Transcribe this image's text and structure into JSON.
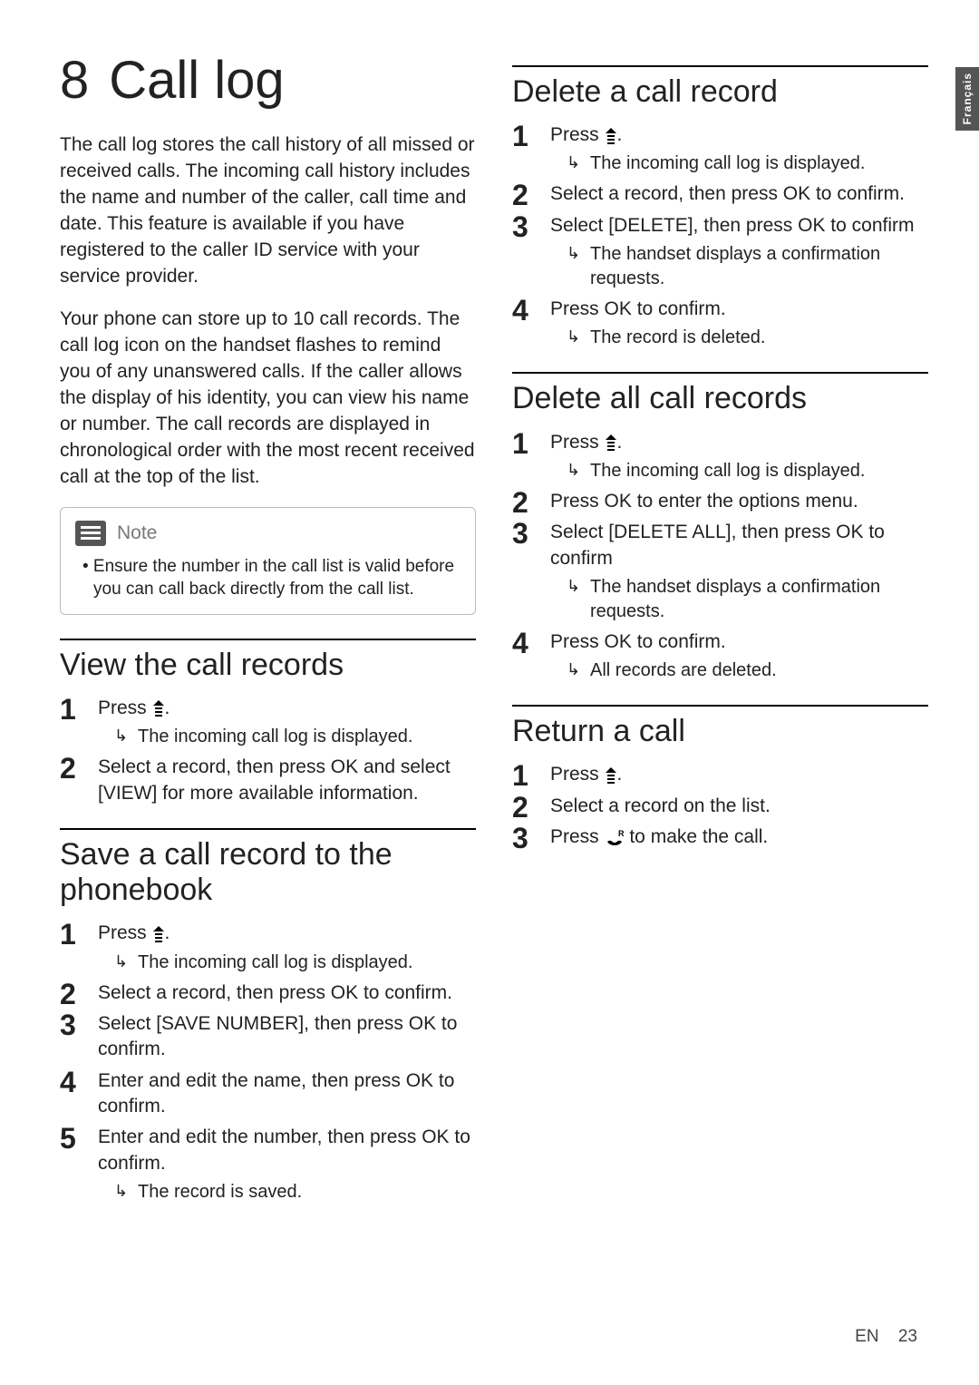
{
  "chapter": {
    "number": "8",
    "title": "Call log"
  },
  "intro_p1": "The call log stores the call history of all missed or received calls. The incoming call history includes the name and number of the caller, call time and date. This feature is available if you have registered to the caller ID service with your service provider.",
  "intro_p2": "Your phone can store up to 10 call records. The call log icon on the handset flashes to remind you of any unanswered calls. If the caller allows the display of his identity, you can view his name or number. The call records are displayed in chronological order with the most recent received call at the top of the list.",
  "note": {
    "label": "Note",
    "body": "• Ensure the number in the call list is valid before you can call back directly from the call list."
  },
  "sections": {
    "view": {
      "title": "View the call records",
      "steps": [
        {
          "text": "Press ",
          "icon": "up-menu",
          "after": ".",
          "sub": [
            "The incoming call log is displayed."
          ]
        },
        {
          "text": "Select a record, then press OK and select [VIEW] for more available information."
        }
      ]
    },
    "save": {
      "title": "Save a call record to the phonebook",
      "steps": [
        {
          "text": "Press ",
          "icon": "up-menu",
          "after": ".",
          "sub": [
            "The incoming call log is displayed."
          ]
        },
        {
          "text": "Select a record, then press OK to confirm."
        },
        {
          "text": "Select [SAVE NUMBER], then press OK to confirm."
        },
        {
          "text": "Enter and edit the name, then press OK to confirm."
        },
        {
          "text": "Enter and edit the number, then press OK to confirm.",
          "sub": [
            "The record is saved."
          ]
        }
      ]
    },
    "delete_one": {
      "title": "Delete a call record",
      "steps": [
        {
          "text": "Press ",
          "icon": "up-menu",
          "after": ".",
          "sub": [
            "The incoming call log is displayed."
          ]
        },
        {
          "text": "Select a record, then press OK to confirm."
        },
        {
          "text": "Select [DELETE], then press OK to confirm",
          "sub": [
            "The handset displays a confirmation requests."
          ]
        },
        {
          "text": "Press OK to confirm.",
          "sub": [
            "The record is deleted."
          ]
        }
      ]
    },
    "delete_all": {
      "title": "Delete all call records",
      "steps": [
        {
          "text": "Press ",
          "icon": "up-menu",
          "after": ".",
          "sub": [
            "The incoming call log is displayed."
          ]
        },
        {
          "text": "Press OK to enter the options menu."
        },
        {
          "text": "Select [DELETE ALL], then press OK to confirm",
          "sub": [
            "The handset displays a confirmation requests."
          ]
        },
        {
          "text": "Press OK to confirm.",
          "sub": [
            "All records are deleted."
          ]
        }
      ]
    },
    "return_call": {
      "title": "Return a call",
      "steps": [
        {
          "text": "Press ",
          "icon": "up-menu",
          "after": "."
        },
        {
          "text": "Select a record on the list."
        },
        {
          "text": "Press ",
          "icon": "call-r",
          "after": " to make the call."
        }
      ]
    }
  },
  "side_tab": "Français",
  "footer": {
    "lang": "EN",
    "page": "23"
  }
}
